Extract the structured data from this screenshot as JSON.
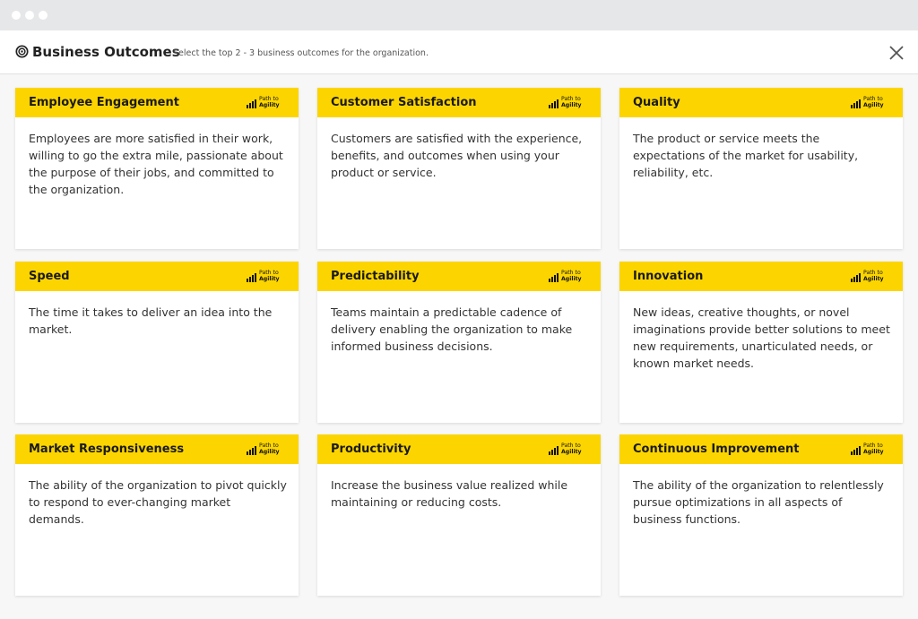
{
  "header": {
    "title": "Business Outcomes",
    "subtitle": "Select the top 2 - 3 business outcomes for the organization.",
    "title_icon": "target-icon",
    "close_icon": "close-icon"
  },
  "brand": {
    "line1": "Path to",
    "line2": "Agility"
  },
  "colors": {
    "accent": "#fcd500",
    "card_background": "#ffffff",
    "page_background": "#f7f7f7"
  },
  "cards": [
    {
      "title": "Employee Engagement",
      "description": "Employees are more satisfied in their work, willing to go the extra mile, passionate about the purpose of their jobs, and committed to the organization."
    },
    {
      "title": "Customer Satisfaction",
      "description": "Customers are satisfied with the experience, benefits, and outcomes when using your product or service."
    },
    {
      "title": "Quality",
      "description": "The product or service meets the expectations of the market for usability, reliability, etc."
    },
    {
      "title": "Speed",
      "description": "The time it takes to deliver an idea into the market."
    },
    {
      "title": "Predictability",
      "description": "Teams maintain a predictable cadence of delivery enabling the organization to make informed business decisions."
    },
    {
      "title": "Innovation",
      "description": "New ideas, creative thoughts, or novel imaginations provide better solutions to meet new requirements, unarticulated needs, or known market needs."
    },
    {
      "title": "Market Responsiveness",
      "description": "The ability of the organization to pivot quickly to respond to ever-changing market demands."
    },
    {
      "title": "Productivity",
      "description": "Increase the business value realized while maintaining or reducing costs."
    },
    {
      "title": "Continuous Improvement",
      "description": "The ability of the organization to relentlessly pursue optimizations in all aspects of business functions."
    }
  ]
}
